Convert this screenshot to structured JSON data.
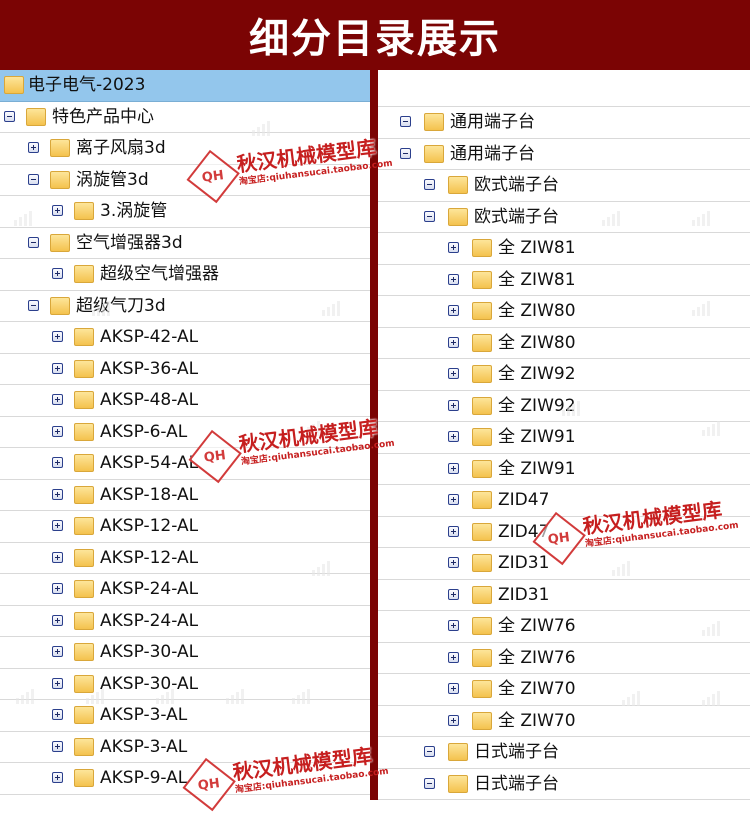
{
  "banner": {
    "title": "细分目录展示"
  },
  "left": {
    "rows": [
      {
        "label": "电子电气-2023",
        "toggle": "none",
        "header": true,
        "indent": 0
      },
      {
        "label": "特色产品中心",
        "toggle": "minus",
        "indent": 0
      },
      {
        "label": "离子风扇3d",
        "toggle": "plus",
        "indent": 1
      },
      {
        "label": "涡旋管3d",
        "toggle": "minus",
        "indent": 1
      },
      {
        "label": "3.涡旋管",
        "toggle": "plus",
        "indent": 2
      },
      {
        "label": "空气增强器3d",
        "toggle": "minus",
        "indent": 1
      },
      {
        "label": "超级空气增强器",
        "toggle": "plus",
        "indent": 2
      },
      {
        "label": "超级气刀3d",
        "toggle": "minus",
        "indent": 1
      },
      {
        "label": "AKSP-42-AL",
        "toggle": "plus",
        "indent": 2
      },
      {
        "label": "AKSP-36-AL",
        "toggle": "plus",
        "indent": 2
      },
      {
        "label": "AKSP-48-AL",
        "toggle": "plus",
        "indent": 2
      },
      {
        "label": "AKSP-6-AL",
        "toggle": "plus",
        "indent": 2
      },
      {
        "label": "AKSP-54-AL",
        "toggle": "plus",
        "indent": 2
      },
      {
        "label": "AKSP-18-AL",
        "toggle": "plus",
        "indent": 2
      },
      {
        "label": "AKSP-12-AL",
        "toggle": "plus",
        "indent": 2
      },
      {
        "label": "AKSP-12-AL",
        "toggle": "plus",
        "indent": 2
      },
      {
        "label": "AKSP-24-AL",
        "toggle": "plus",
        "indent": 2
      },
      {
        "label": "AKSP-24-AL",
        "toggle": "plus",
        "indent": 2
      },
      {
        "label": "AKSP-30-AL",
        "toggle": "plus",
        "indent": 2
      },
      {
        "label": "AKSP-30-AL",
        "toggle": "plus",
        "indent": 2
      },
      {
        "label": "AKSP-3-AL",
        "toggle": "plus",
        "indent": 2
      },
      {
        "label": "AKSP-3-AL",
        "toggle": "plus",
        "indent": 2
      },
      {
        "label": "AKSP-9-AL",
        "toggle": "plus",
        "indent": 2
      }
    ]
  },
  "right": {
    "rows": [
      {
        "label": "",
        "toggle": "none",
        "indent": 0
      },
      {
        "label": "通用端子台",
        "toggle": "minus",
        "indent": 0
      },
      {
        "label": "通用端子台",
        "toggle": "minus",
        "indent": 0
      },
      {
        "label": "欧式端子台",
        "toggle": "minus",
        "indent": 1
      },
      {
        "label": "欧式端子台",
        "toggle": "minus",
        "indent": 1
      },
      {
        "label": "全 ZIW81",
        "toggle": "plus",
        "indent": 2
      },
      {
        "label": "全 ZIW81",
        "toggle": "plus",
        "indent": 2
      },
      {
        "label": "全 ZIW80",
        "toggle": "plus",
        "indent": 2
      },
      {
        "label": "全 ZIW80",
        "toggle": "plus",
        "indent": 2
      },
      {
        "label": "全 ZIW92",
        "toggle": "plus",
        "indent": 2
      },
      {
        "label": "全 ZIW92",
        "toggle": "plus",
        "indent": 2
      },
      {
        "label": "全 ZIW91",
        "toggle": "plus",
        "indent": 2
      },
      {
        "label": "全 ZIW91",
        "toggle": "plus",
        "indent": 2
      },
      {
        "label": "ZID47",
        "toggle": "plus",
        "indent": 2
      },
      {
        "label": "ZID47",
        "toggle": "plus",
        "indent": 2
      },
      {
        "label": "ZID31",
        "toggle": "plus",
        "indent": 2
      },
      {
        "label": "ZID31",
        "toggle": "plus",
        "indent": 2
      },
      {
        "label": "全 ZIW76",
        "toggle": "plus",
        "indent": 2
      },
      {
        "label": "全 ZIW76",
        "toggle": "plus",
        "indent": 2
      },
      {
        "label": "全 ZIW70",
        "toggle": "plus",
        "indent": 2
      },
      {
        "label": "全 ZIW70",
        "toggle": "plus",
        "indent": 2
      },
      {
        "label": "日式端子台",
        "toggle": "minus",
        "indent": 1
      },
      {
        "label": "日式端子台",
        "toggle": "minus",
        "indent": 1
      }
    ]
  },
  "watermark": {
    "badge": "QH",
    "brand": "秋汉机械模型库",
    "shop": "淘宝店:qiuhansucai.taobao.com"
  },
  "colors": {
    "banner": "#7b0404",
    "divider": "#7b0404",
    "header_row": "#93c6ec",
    "folder": "#f4c24e",
    "watermark": "#c61f1f"
  },
  "icons": {
    "folder": "folder-icon",
    "expand": "expand-plus-icon",
    "collapse": "collapse-minus-icon"
  }
}
